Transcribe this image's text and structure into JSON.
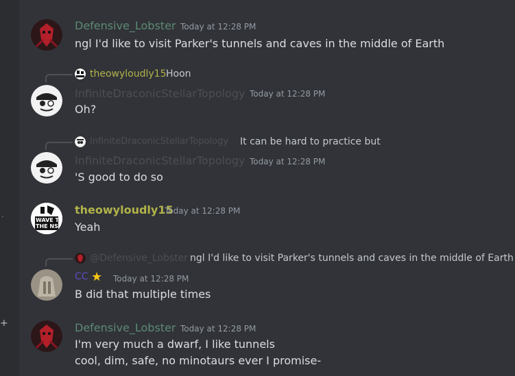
{
  "colors": {
    "background": "#313338",
    "lobster_name": "#5c8a72",
    "infinite_name": "#4b4e55",
    "theowy_name": "#b2b34a",
    "cc_name": "#5c4cc2",
    "timestamp": "#949ba4",
    "text": "#dbdee1"
  },
  "icons": {
    "lobster_avatar": "red-mask-avatar-icon",
    "infinite_avatar": "skull-face-avatar-icon",
    "theowy_avatar": "wave-to-the-nsa-avatar-icon",
    "cc_avatar": "statue-avatar-icon",
    "cc_badge": "star-icon"
  },
  "messages": [
    {
      "author": "Defensive_Lobster",
      "timestamp": "Today at 12:28 PM",
      "lines": [
        "ngl I'd like to visit Parker's tunnels and caves in the middle of Earth"
      ]
    },
    {
      "reply": {
        "author": "theowyloudly15",
        "text": "Hoon"
      },
      "author": "InfiniteDraconicStellarTopology",
      "timestamp": "Today at 12:28 PM",
      "lines": [
        "Oh?"
      ]
    },
    {
      "reply": {
        "author": "InfiniteDraconicStellarTopology",
        "text": "It can be hard to practice but"
      },
      "author": "InfiniteDraconicStellarTopology",
      "timestamp": "Today at 12:28 PM",
      "lines": [
        "'S good to do so"
      ]
    },
    {
      "author": "theowyloudly15",
      "timestamp": "Today at 12:28 PM",
      "lines": [
        "Yeah"
      ],
      "avatar_text": [
        "WAVE TO",
        "THE NSA"
      ]
    },
    {
      "reply": {
        "author": "@Defensive_Lobster",
        "text": "ngl I'd like to visit Parker's tunnels and caves in the middle of Earth"
      },
      "author": "CC",
      "timestamp": "Today at 12:28 PM",
      "lines": [
        "B did that multiple times"
      ]
    },
    {
      "author": "Defensive_Lobster",
      "timestamp": "Today at 12:28 PM",
      "lines": [
        "I'm very much a dwarf, I like tunnels",
        "cool, dim, safe, no minotaurs ever I promise-"
      ]
    }
  ]
}
